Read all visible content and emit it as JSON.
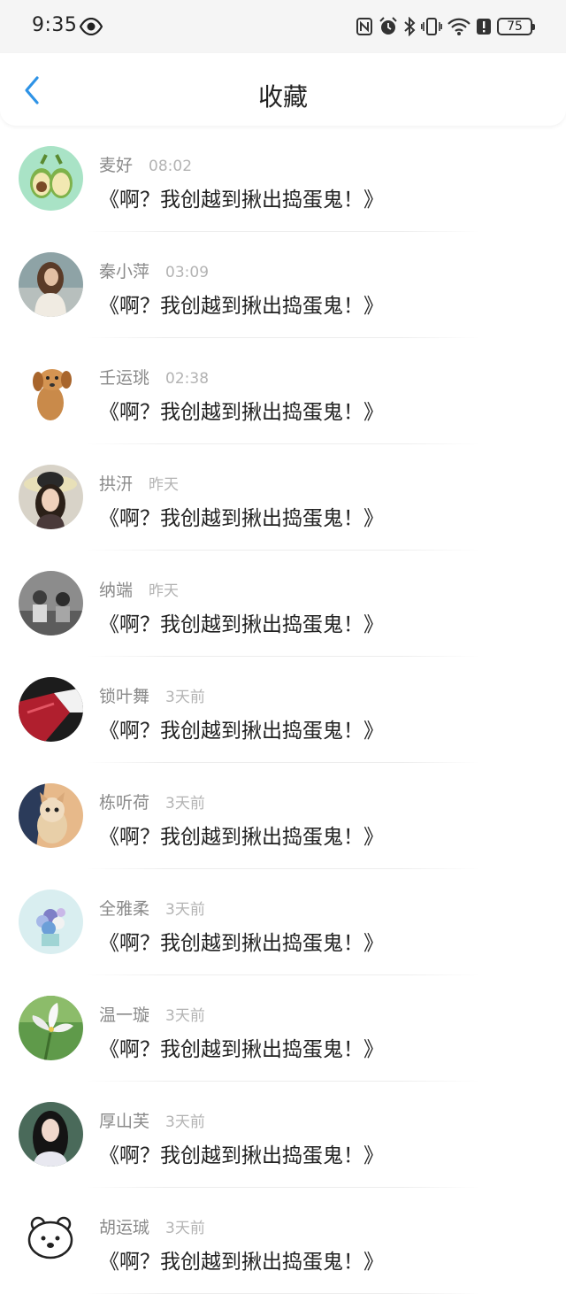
{
  "status_bar": {
    "time": "9:35",
    "battery": "75"
  },
  "header": {
    "title": "收藏"
  },
  "favorites": [
    {
      "name": "麦好",
      "time": "08:02",
      "content": "《啊？我创越到揪出捣蛋鬼！》",
      "avatar": "avocado-avatar"
    },
    {
      "name": "秦小萍",
      "time": "03:09",
      "content": "《啊？我创越到揪出捣蛋鬼！》",
      "avatar": "woman-avatar"
    },
    {
      "name": "壬运珧",
      "time": "02:38",
      "content": "《啊？我创越到揪出捣蛋鬼！》",
      "avatar": "puppy-avatar"
    },
    {
      "name": "拱汧",
      "time": "昨天",
      "content": "《啊？我创越到揪出捣蛋鬼！》",
      "avatar": "girl-hat-avatar"
    },
    {
      "name": "纳端",
      "time": "昨天",
      "content": "《啊？我创越到揪出捣蛋鬼！》",
      "avatar": "couple-avatar"
    },
    {
      "name": "锁叶舞",
      "time": "3天前",
      "content": "《啊？我创越到揪出捣蛋鬼！》",
      "avatar": "red-fabric-avatar"
    },
    {
      "name": "栋听荷",
      "time": "3天前",
      "content": "《啊？我创越到揪出捣蛋鬼！》",
      "avatar": "kitten-avatar"
    },
    {
      "name": "全雅柔",
      "time": "3天前",
      "content": "《啊？我创越到揪出捣蛋鬼！》",
      "avatar": "flowers-avatar"
    },
    {
      "name": "温一璇",
      "time": "3天前",
      "content": "《啊？我创越到揪出捣蛋鬼！》",
      "avatar": "white-flower-avatar"
    },
    {
      "name": "厚山芙",
      "time": "3天前",
      "content": "《啊？我创越到揪出捣蛋鬼！》",
      "avatar": "dark-hair-avatar"
    },
    {
      "name": "胡运珹",
      "time": "3天前",
      "content": "《啊？我创越到揪出捣蛋鬼！》",
      "avatar": "bear-avatar"
    }
  ],
  "colors": {
    "accent": "#2e93e6",
    "name_text": "#8a8a8a",
    "time_text": "#b3b3b3",
    "content_text": "#222222"
  }
}
